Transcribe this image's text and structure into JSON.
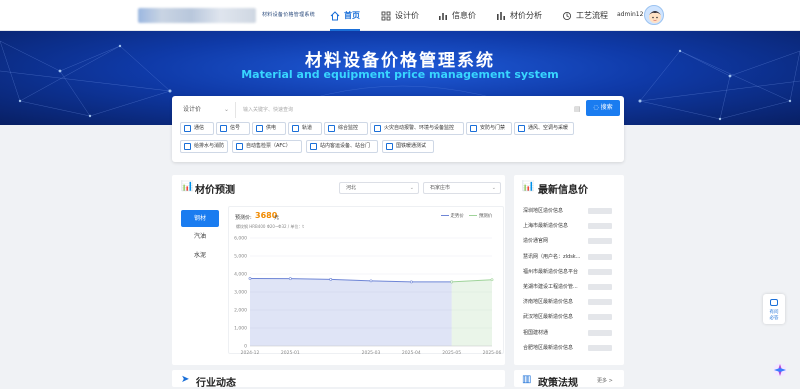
{
  "header": {
    "logo_subtext": "材料设备价格管理系统",
    "nav": [
      {
        "label": "首页",
        "icon": "home-icon",
        "active": true
      },
      {
        "label": "设计价",
        "icon": "design-price-icon",
        "active": false
      },
      {
        "label": "信息价",
        "icon": "info-price-icon",
        "active": false
      },
      {
        "label": "材价分析",
        "icon": "analysis-icon",
        "active": false
      },
      {
        "label": "工艺流程",
        "icon": "process-icon",
        "active": false
      }
    ],
    "user": "admin12"
  },
  "banner": {
    "title": "材料设备价格管理系统",
    "subtitle": "Material and equipment price management system"
  },
  "search": {
    "type_value": "设计价",
    "placeholder": "输入关键字、快速查询",
    "button": "搜索",
    "tags": [
      "通信",
      "信号",
      "供电",
      "轨道",
      "综合监控",
      "火灾自动报警、环境与设备监控",
      "安防与门禁",
      "通风、空调与采暖",
      "给排水与消防",
      "自动售检票（AFC）",
      "站内客运设备、站台门",
      "国铁暖通测试"
    ]
  },
  "forecast": {
    "title": "材价预测",
    "province": "河北",
    "city": "石家庄市",
    "tabs": [
      "钢材",
      "汽油",
      "水泥"
    ],
    "predicted_label": "预测价:",
    "predicted_value": "3680",
    "predicted_unit": "元",
    "spec": "螺纹钢 HRB400 Φ20~Φ32 / 单位：t",
    "legend": [
      "走势价",
      "预测价"
    ]
  },
  "chart_data": {
    "type": "line",
    "x": [
      "2024-12",
      "2025-01",
      "2025-02",
      "2025-03",
      "2025-04",
      "2025-05",
      "2025-06"
    ],
    "series": [
      {
        "name": "走势价",
        "values": [
          3750,
          3740,
          3700,
          3620,
          3560,
          3560,
          null
        ],
        "color": "#6f86d6"
      },
      {
        "name": "预测价",
        "values": [
          null,
          null,
          null,
          null,
          null,
          3560,
          3680
        ],
        "color": "#9fd39a"
      }
    ],
    "xlabels": [
      "2024-12",
      "2025-01",
      "2025-03",
      "2025-04",
      "2025-05",
      "2025-06"
    ],
    "ylim": [
      0,
      6000
    ],
    "yticks": [
      "6,000",
      "5,000",
      "4,000",
      "3,000",
      "2,000",
      "1,000",
      "0"
    ],
    "grid": true,
    "legend_position": "top-right"
  },
  "news": {
    "title": "最新信息价",
    "items": [
      "深圳地区造价信息",
      "上海市最新造价信息",
      "造价通官网",
      "慧讯网（用户名：zldsk...",
      "福州市最新造价信息平台",
      "芜湖市建设工程造价管...",
      "济南地区最新造价信息",
      "武汉地区最新造价信息",
      "祖国建材通",
      "合肥地区最新造价信息"
    ]
  },
  "industry": {
    "title": "行业动态"
  },
  "policy": {
    "title": "政策法规",
    "more": "更多 >"
  },
  "fab": {
    "label1": "有问",
    "label2": "必答"
  }
}
